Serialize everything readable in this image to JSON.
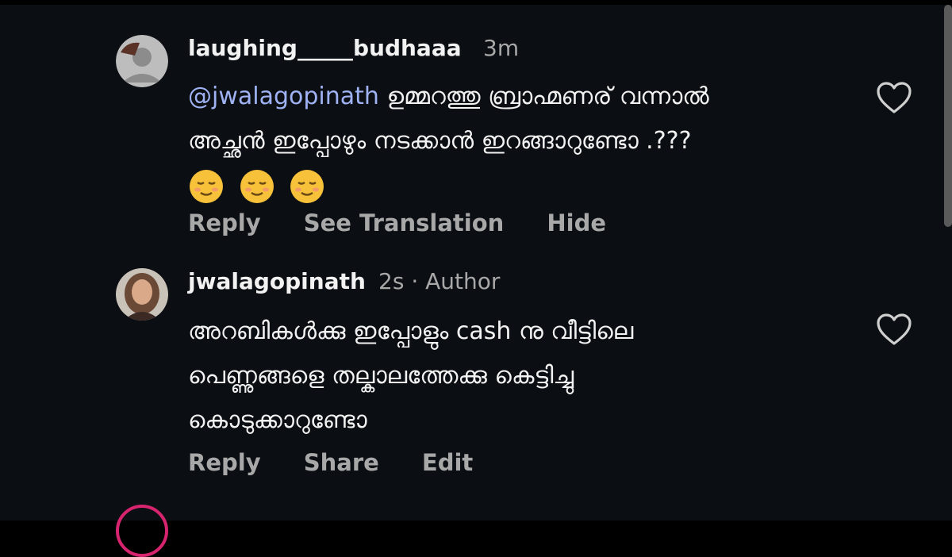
{
  "comments": [
    {
      "username": "laughing_____budhaaa",
      "time": "3m",
      "mention": "@jwalagopinath",
      "line1": "ഉമ്മറത്തു ബ്രാഹ്മണര് വന്നാൽ",
      "line2": "അച്ഛൻ ഇപ്പോഴും നടക്കാൻ ഇറങ്ങാറുണ്ടോ .???",
      "actions": {
        "reply": "Reply",
        "translate": "See Translation",
        "hide": "Hide"
      }
    },
    {
      "username": "jwalagopinath",
      "time": "2s",
      "separator": "·",
      "badge": "Author",
      "line1": "അറബികൾക്കു ഇപ്പോളും cash നു വീട്ടിലെ",
      "line2": "പെണ്ണുങ്ങളെ തല്കാലത്തേക്കു കെട്ടിച്ചു",
      "line3": "കൊടുക്കാറുണ്ടോ",
      "actions": {
        "reply": "Reply",
        "share": "Share",
        "edit": "Edit"
      }
    }
  ],
  "icons": {
    "like": "heart-outline-icon",
    "emoji": "relieved-face-emoji"
  },
  "colors": {
    "background": "#0b0e13",
    "text": "#f2f2f2",
    "secondary": "#a8a8a8",
    "mention": "#9fb2f3"
  }
}
